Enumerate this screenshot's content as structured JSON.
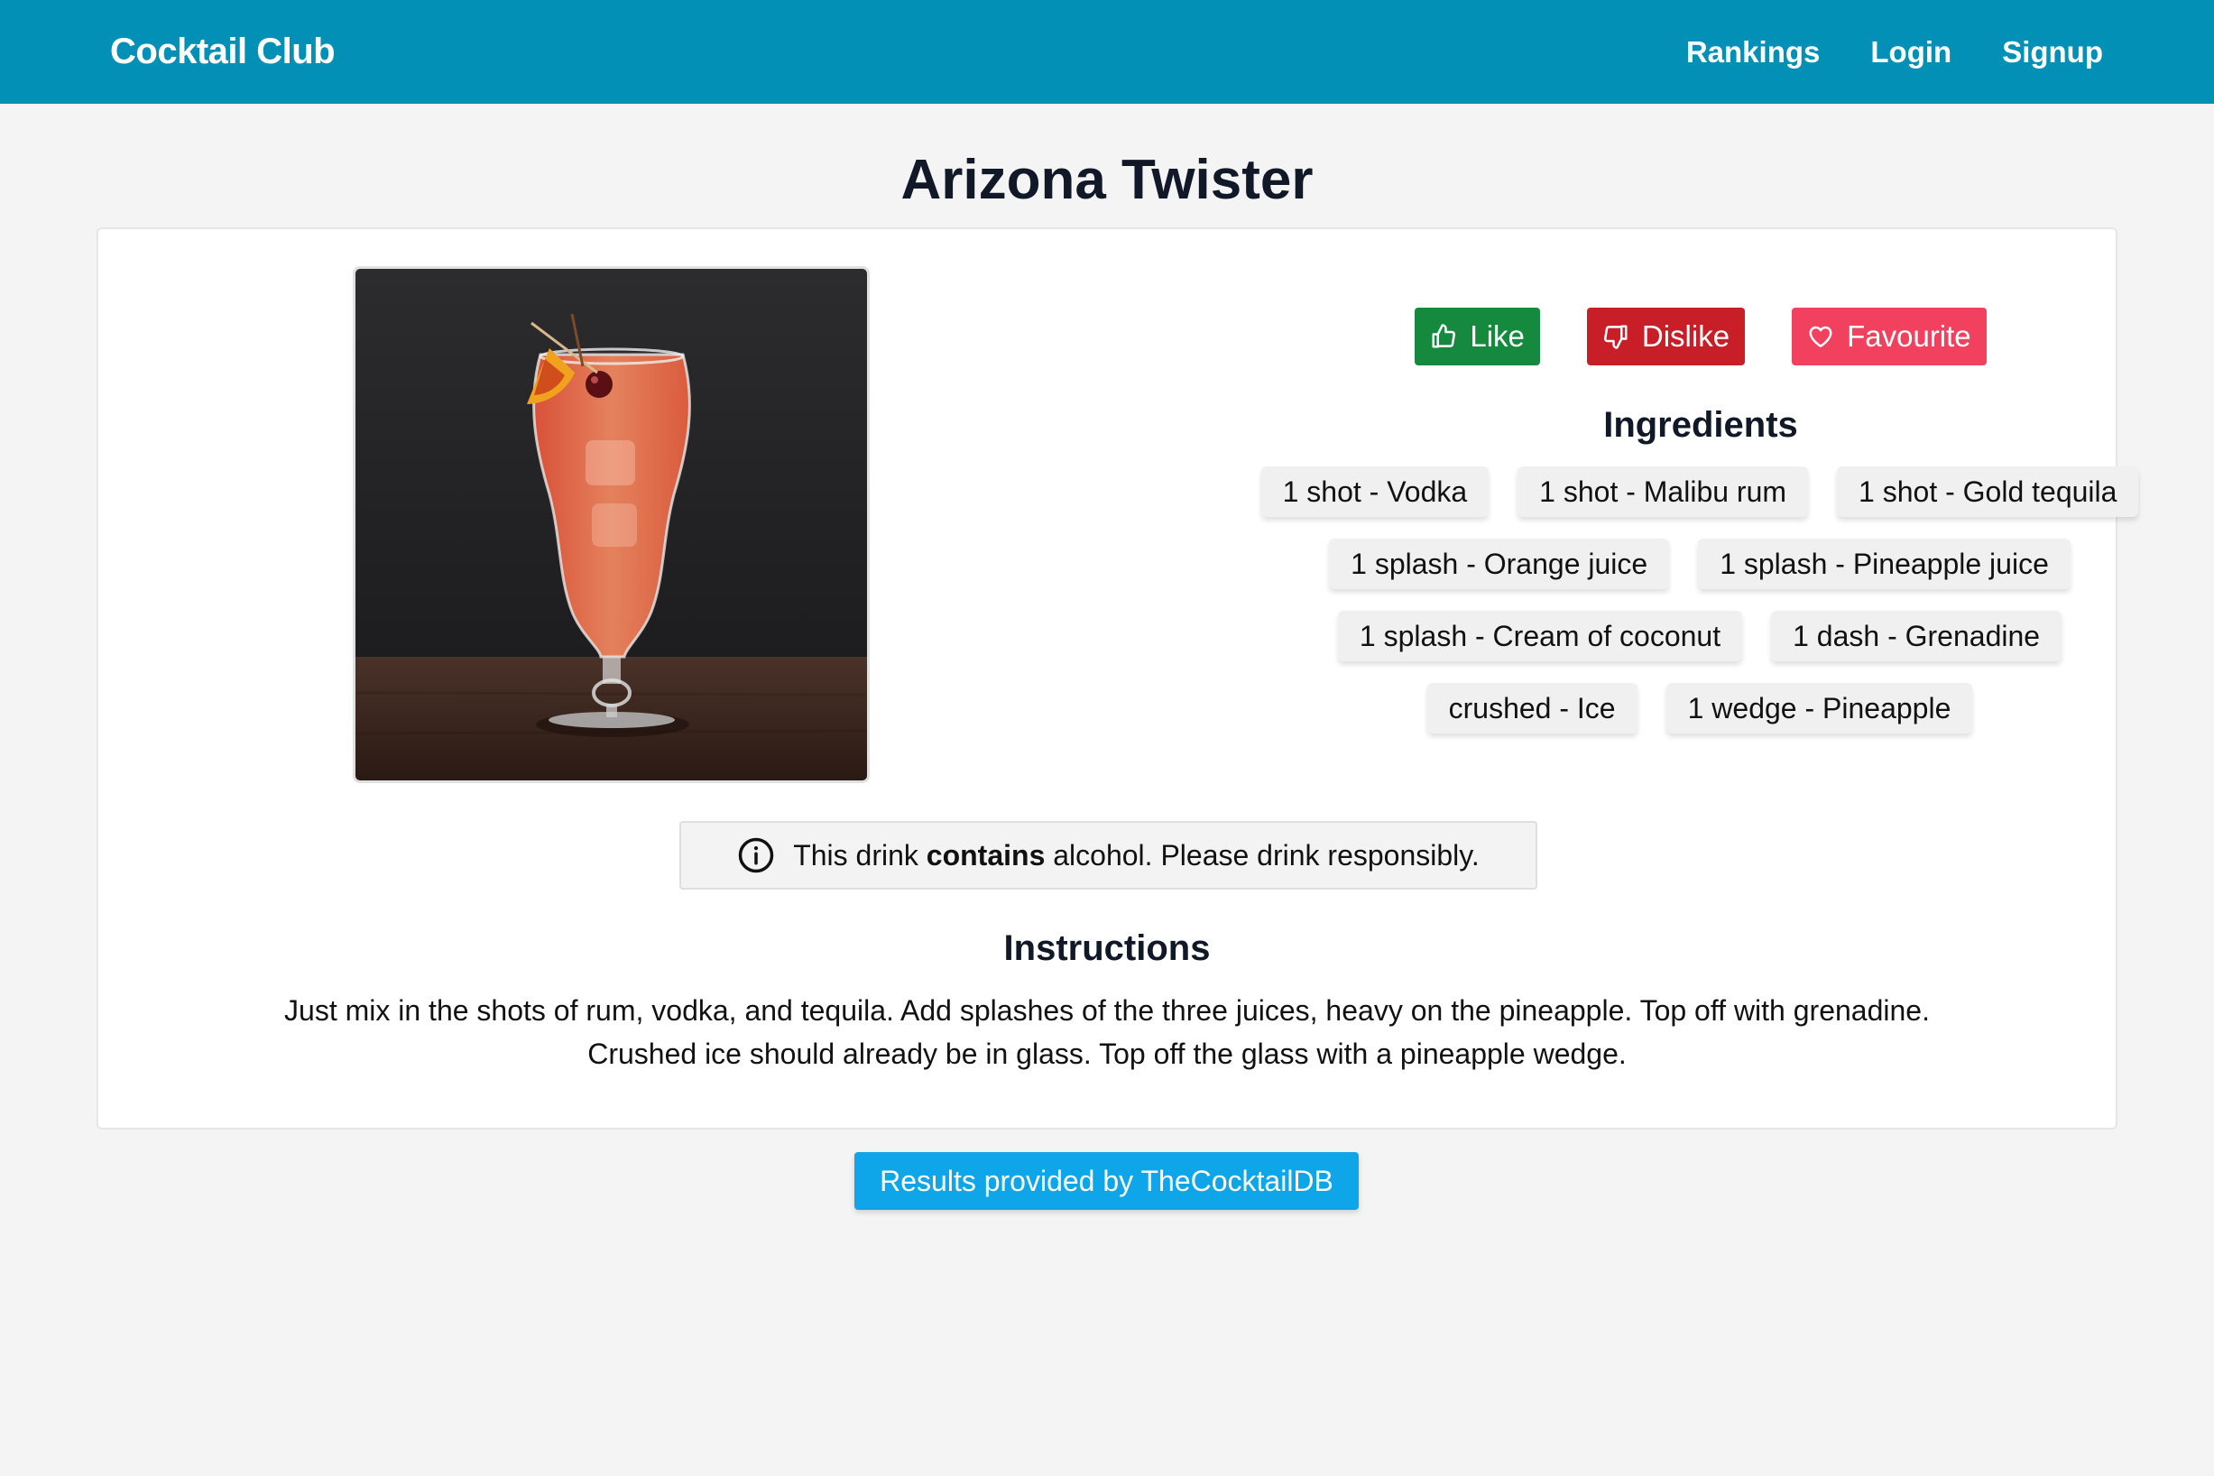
{
  "navbar": {
    "brand": "Cocktail Club",
    "links": [
      "Rankings",
      "Login",
      "Signup"
    ],
    "background": "#0390b6"
  },
  "drink": {
    "title": "Arizona Twister",
    "photo_alt": "Arizona Twister cocktail in hurricane glass"
  },
  "actions": {
    "like_label": "Like",
    "dislike_label": "Dislike",
    "favourite_label": "Favourite",
    "like_icon": "thumbs-up-icon",
    "dislike_icon": "thumbs-down-icon",
    "favourite_icon": "heart-icon",
    "colors": {
      "like": "#158a3f",
      "dislike": "#c81e27",
      "favourite": "#f2415f"
    }
  },
  "ingredients": {
    "title": "Ingredients",
    "rows": [
      [
        "1 shot - Vodka",
        "1 shot - Malibu rum",
        "1 shot - Gold tequila"
      ],
      [
        "1 splash - Orange juice",
        "1 splash - Pineapple juice"
      ],
      [
        "1 splash - Cream of coconut",
        "1 dash - Grenadine"
      ],
      [
        "crushed - Ice",
        "1 wedge - Pineapple"
      ]
    ]
  },
  "alert": {
    "icon": "info-icon",
    "prefix": "This drink ",
    "emphasis": "contains",
    "suffix": " alcohol. Please drink responsibly."
  },
  "instructions": {
    "title": "Instructions",
    "line1": "Just mix in the shots of rum, vodka, and tequila. Add splashes of the three juices, heavy on the pineapple. Top off with grenadine.",
    "line2": "Crushed ice should already be in glass. Top off the glass with a pineapple wedge."
  },
  "footer": {
    "credit": "Results provided by TheCocktailDB"
  }
}
